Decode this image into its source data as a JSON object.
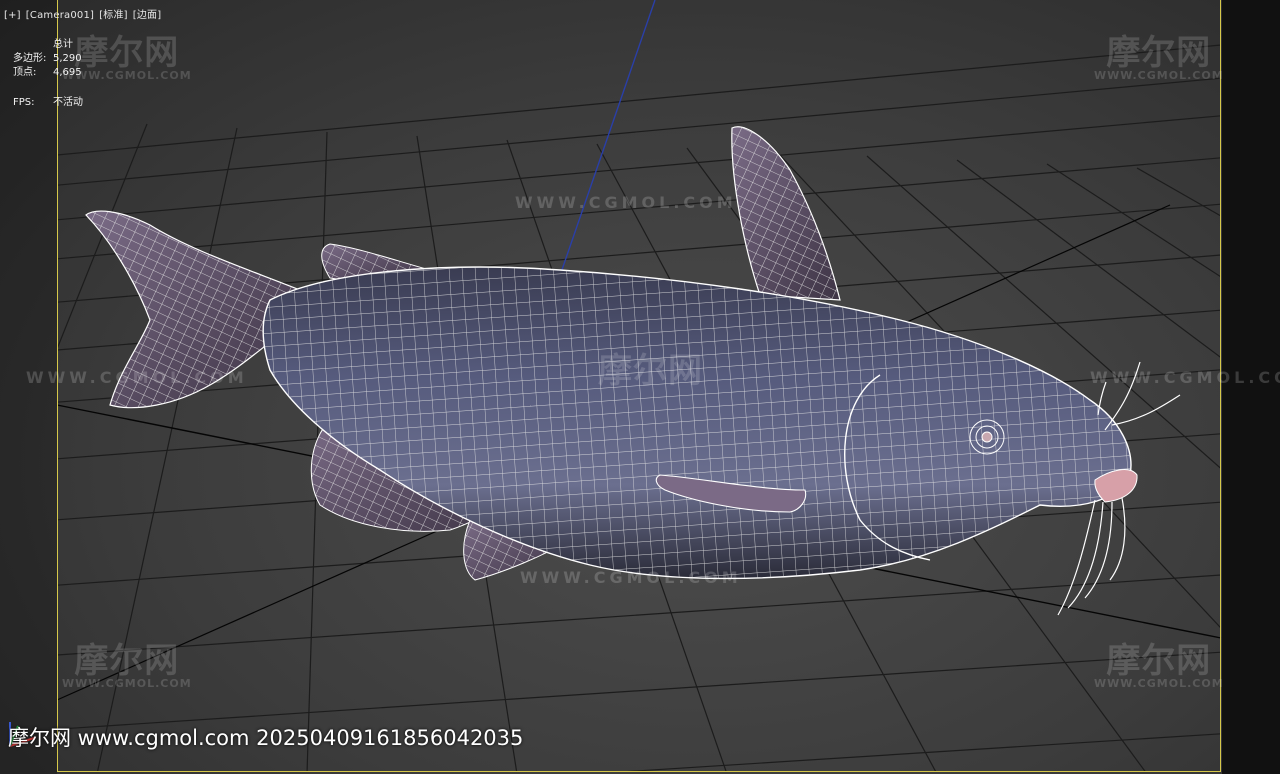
{
  "viewport": {
    "menu": [
      "[+]",
      "[Camera001]",
      "[标准]",
      "[边面]"
    ],
    "stats_header": "总计",
    "stats": [
      {
        "label": "多边形:",
        "value": "5,290"
      },
      {
        "label": "顶点:",
        "value": "4,695"
      }
    ],
    "fps_label": "FPS:",
    "fps_value": "不活动"
  },
  "watermark": {
    "cn": "摩尔网",
    "en": "WWW.CGMOL.COM",
    "line": "WWW.CGMOL.COM"
  },
  "footer": {
    "text": "摩尔网 www.cgmol.com 20250409161856042035"
  },
  "colors": {
    "frame": "#d6c84a",
    "grid": "#1a1a1a",
    "wire": "#ffffff",
    "fish_body": "#4a4e6a",
    "z_axis": "#2a3fa8"
  },
  "icons": [
    "axis-gizmo-icon"
  ]
}
